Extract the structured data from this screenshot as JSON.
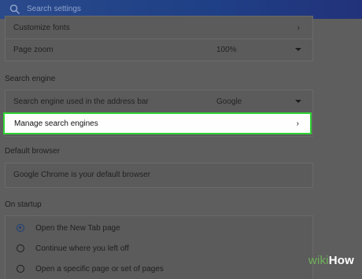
{
  "search": {
    "placeholder": "Search settings"
  },
  "appearance": {
    "customize_fonts_label": "Customize fonts",
    "page_zoom_label": "Page zoom",
    "page_zoom_value": "100%"
  },
  "search_engine": {
    "section_title": "Search engine",
    "address_bar_label": "Search engine used in the address bar",
    "address_bar_value": "Google",
    "manage_label": "Manage search engines"
  },
  "default_browser": {
    "section_title": "Default browser",
    "status": "Google Chrome is your default browser"
  },
  "on_startup": {
    "section_title": "On startup",
    "options": [
      {
        "label": "Open the New Tab page",
        "selected": true
      },
      {
        "label": "Continue where you left off",
        "selected": false
      },
      {
        "label": "Open a specific page or set of pages",
        "selected": false
      }
    ]
  },
  "watermark": {
    "wiki": "wiki",
    "how": "How"
  },
  "colors": {
    "highlight_border": "#31d335",
    "header": "#1f3f86"
  }
}
